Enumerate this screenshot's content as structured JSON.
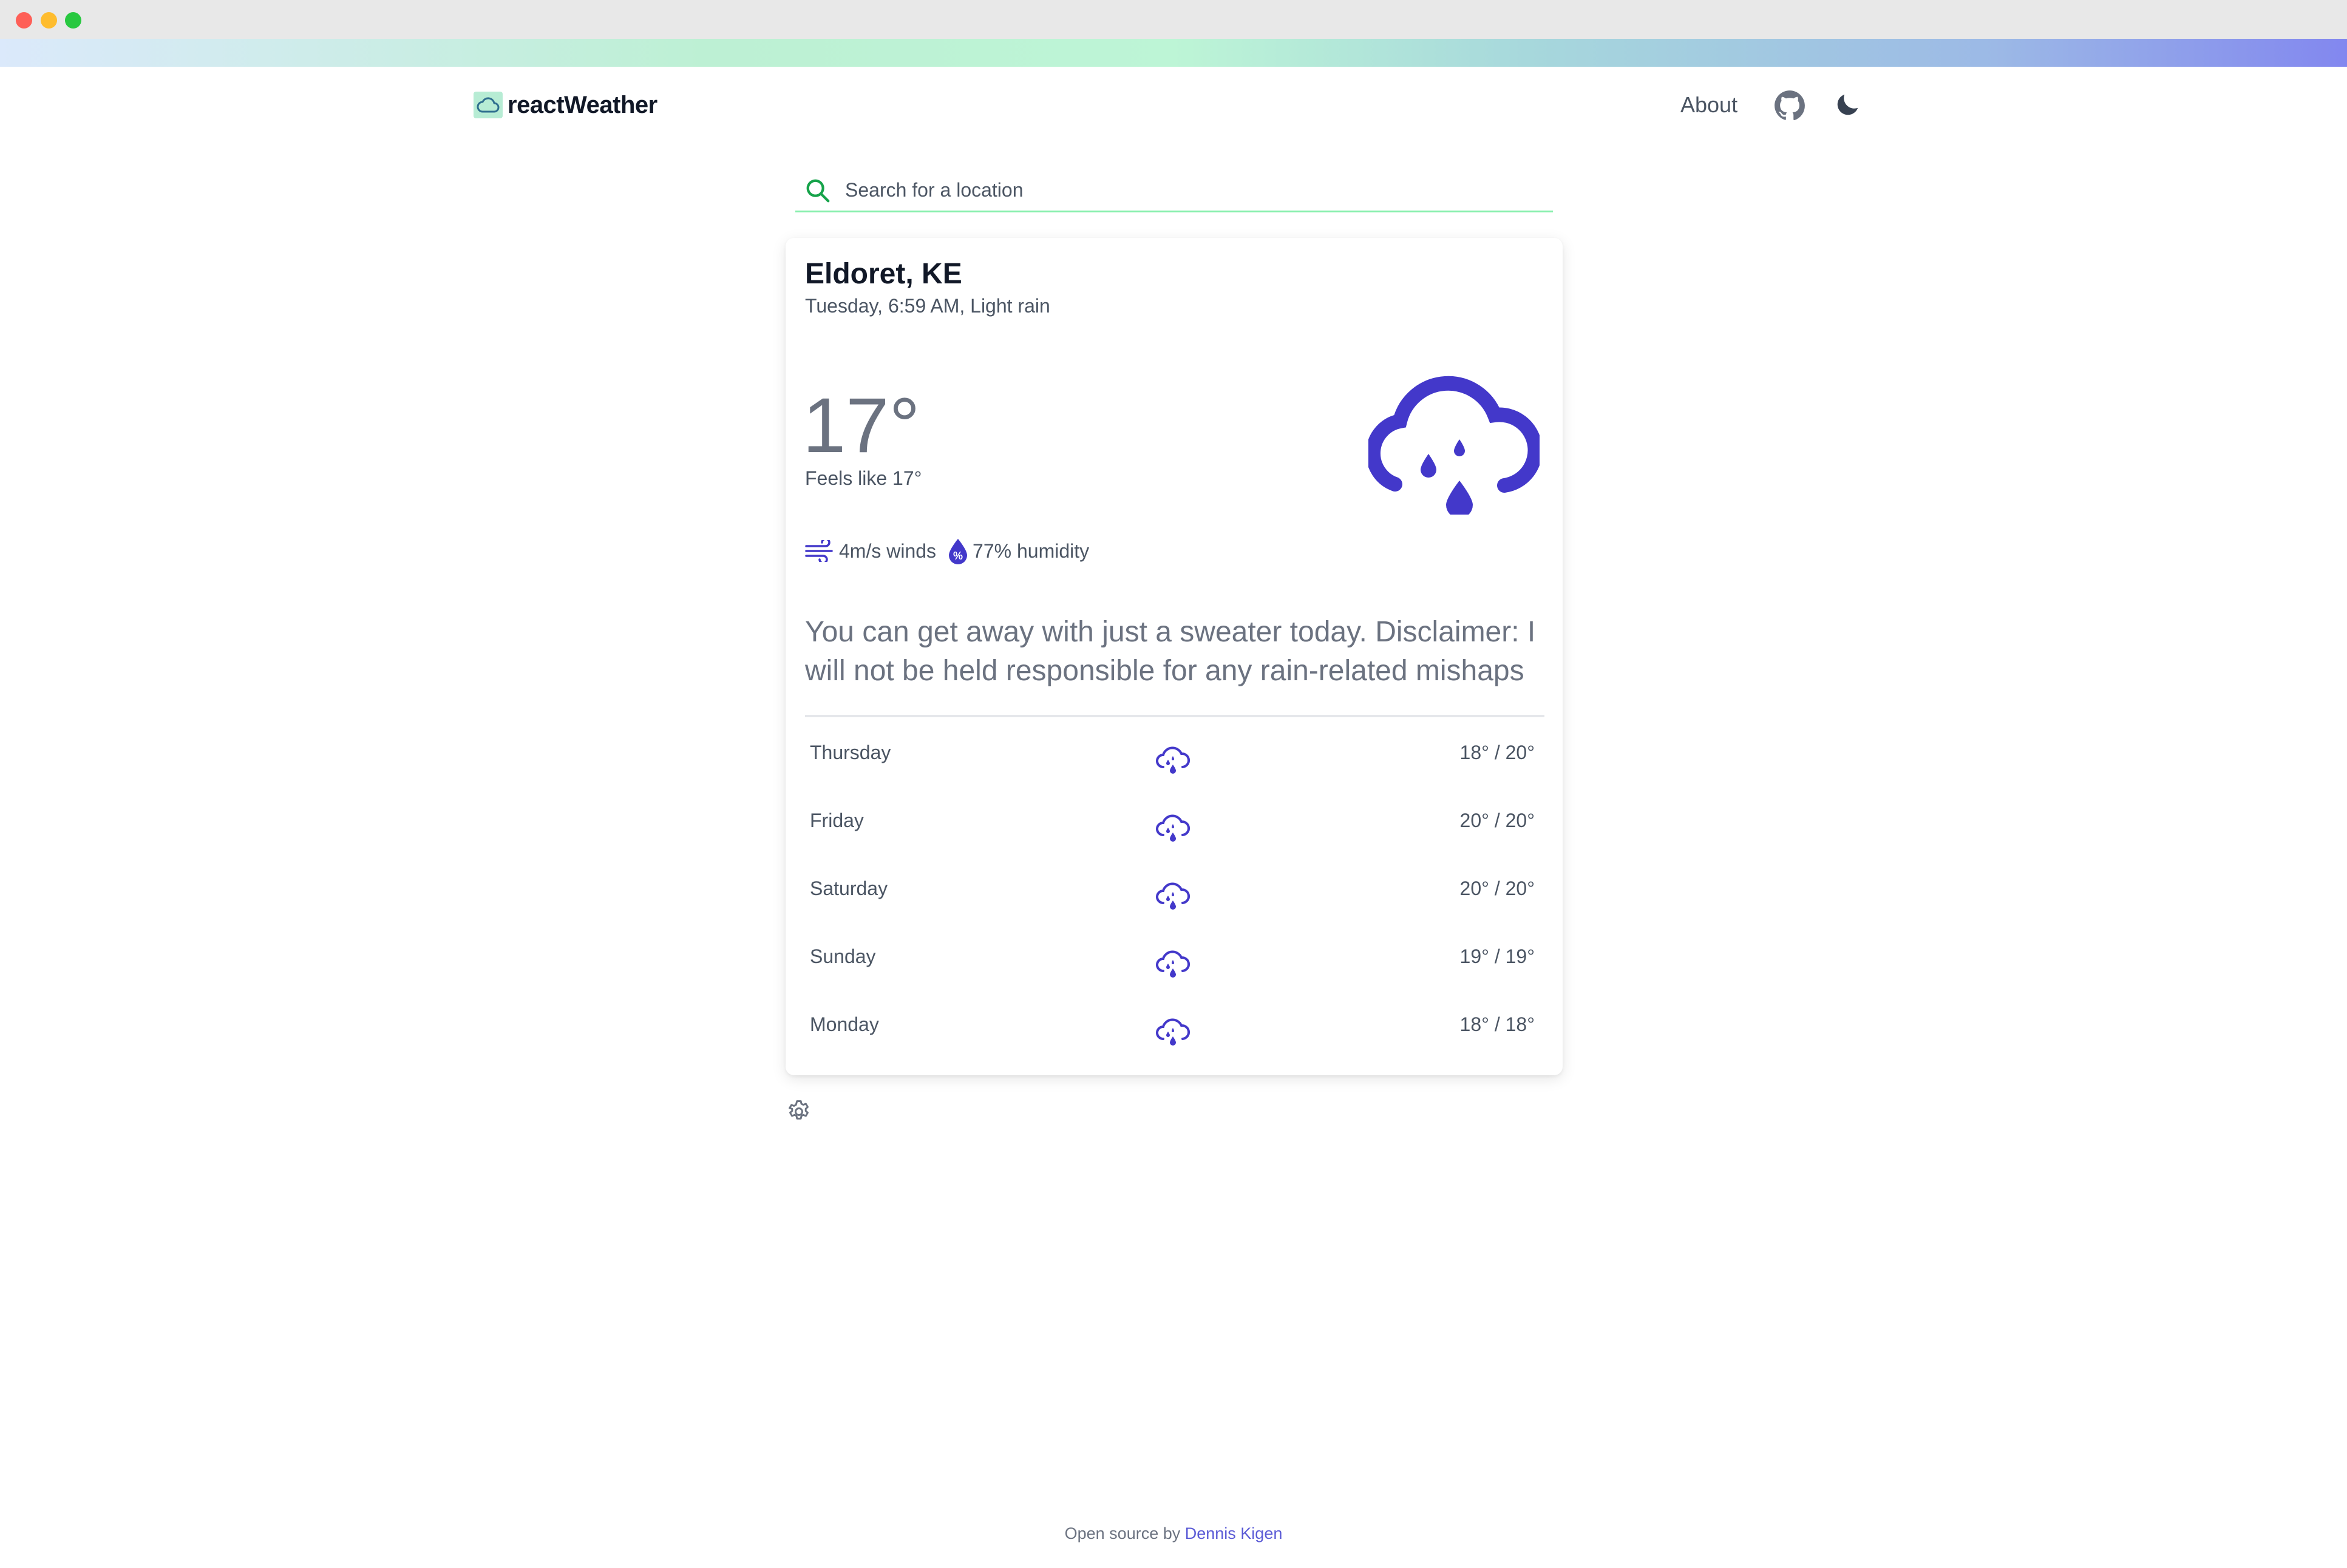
{
  "window": {
    "controls": [
      "close",
      "minimize",
      "maximize"
    ]
  },
  "header": {
    "logo_text": "reactWeather",
    "nav_about": "About",
    "github_icon": "github-icon",
    "theme_icon": "moon-icon"
  },
  "search": {
    "placeholder": "Search for a location",
    "value": ""
  },
  "current": {
    "location": "Eldoret, KE",
    "subline": "Tuesday, 6:59 AM, Light rain",
    "temperature": "17°",
    "feels_like": "Feels like 17°",
    "icon": "cloud-rain-icon",
    "winds": "4m/s winds",
    "humidity": "77% humidity",
    "advice": "You can get away with just a sweater today. Disclaimer: I will not be held responsible for any rain-related mishaps"
  },
  "forecast": [
    {
      "day": "Thursday",
      "icon": "cloud-rain-icon",
      "temps": "18° / 20°"
    },
    {
      "day": "Friday",
      "icon": "cloud-rain-icon",
      "temps": "20° / 20°"
    },
    {
      "day": "Saturday",
      "icon": "cloud-rain-icon",
      "temps": "20° / 20°"
    },
    {
      "day": "Sunday",
      "icon": "cloud-rain-icon",
      "temps": "19° / 19°"
    },
    {
      "day": "Monday",
      "icon": "cloud-rain-icon",
      "temps": "18° / 18°"
    }
  ],
  "settings_icon": "gear-icon",
  "footer": {
    "prefix": "Open source by",
    "author": "Dennis Kigen"
  },
  "colors": {
    "accent": "#4338ca",
    "search_border": "#86efac",
    "search_icon": "#16a34a",
    "link": "#5b5bd6"
  }
}
